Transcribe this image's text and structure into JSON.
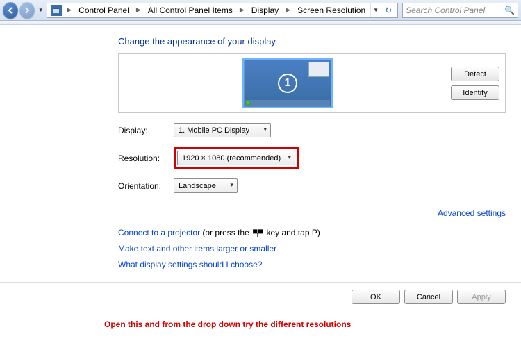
{
  "breadcrumb": {
    "items": [
      "Control Panel",
      "All Control Panel Items",
      "Display",
      "Screen Resolution"
    ]
  },
  "search": {
    "placeholder": "Search Control Panel"
  },
  "page": {
    "title": "Change the appearance of your display"
  },
  "preview": {
    "monitor_number": "1",
    "detect_label": "Detect",
    "identify_label": "Identify"
  },
  "form": {
    "display_label": "Display:",
    "display_value": "1. Mobile PC Display",
    "resolution_label": "Resolution:",
    "resolution_value": "1920 × 1080 (recommended)",
    "orientation_label": "Orientation:",
    "orientation_value": "Landscape"
  },
  "links": {
    "advanced": "Advanced settings",
    "projector_link": "Connect to a projector",
    "projector_suffix_a": " (or press the ",
    "projector_suffix_b": " key and tap P)",
    "textsize": "Make text and other items larger or smaller",
    "help": "What display settings should I choose?"
  },
  "footer": {
    "ok": "OK",
    "cancel": "Cancel",
    "apply": "Apply"
  },
  "annotation": "Open this and from the drop down try the different resolutions"
}
